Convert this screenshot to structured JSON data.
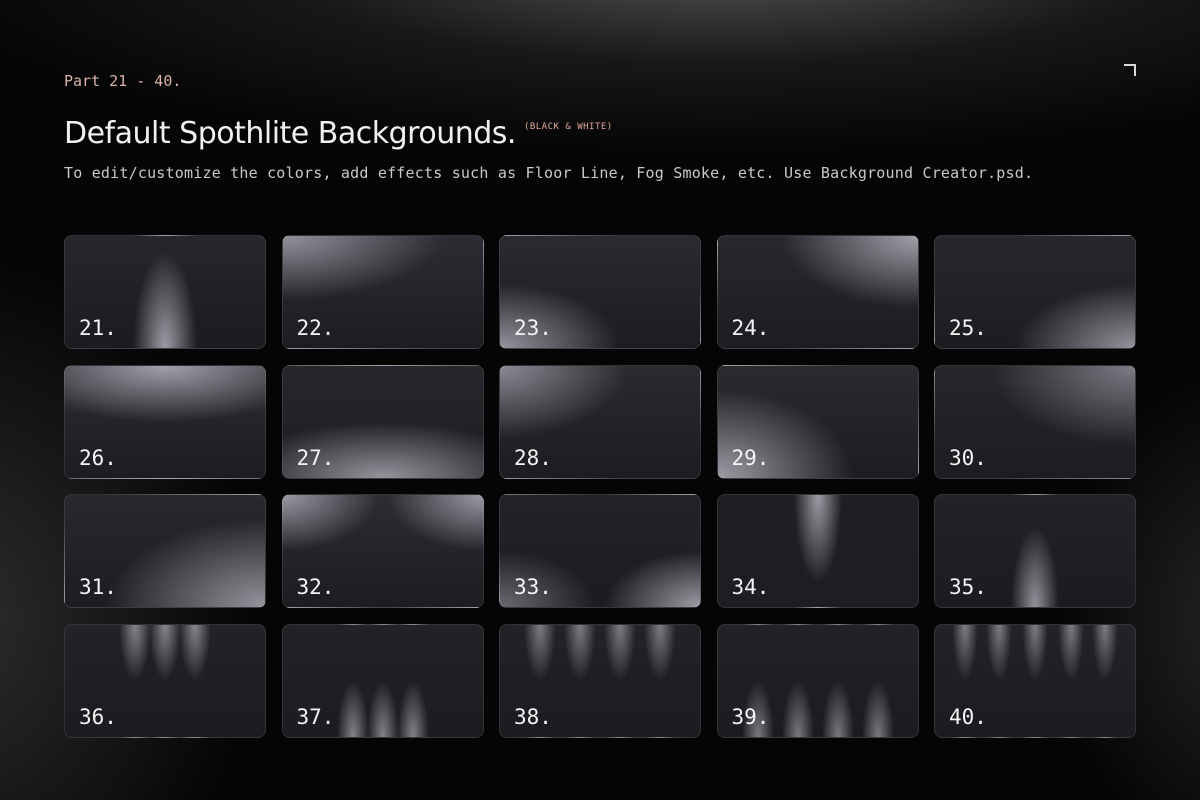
{
  "header": {
    "part": "Part 21 - 40.",
    "title": "Default Spothlite Backgrounds.",
    "tag": "(BLACK & WHITE)",
    "subtitle": "To edit/customize the colors, add effects such as Floor Line, Fog Smoke, etc. Use Background Creator.psd."
  },
  "colors": {
    "accent": "#d9b3a9",
    "tag": "#e0a79a",
    "text": "#f1f1f1",
    "background": "#050505"
  },
  "cards": [
    {
      "label": "21."
    },
    {
      "label": "22."
    },
    {
      "label": "23."
    },
    {
      "label": "24."
    },
    {
      "label": "25."
    },
    {
      "label": "26."
    },
    {
      "label": "27."
    },
    {
      "label": "28."
    },
    {
      "label": "29."
    },
    {
      "label": "30."
    },
    {
      "label": "31."
    },
    {
      "label": "32."
    },
    {
      "label": "33."
    },
    {
      "label": "34."
    },
    {
      "label": "35."
    },
    {
      "label": "36."
    },
    {
      "label": "37."
    },
    {
      "label": "38."
    },
    {
      "label": "39."
    },
    {
      "label": "40."
    }
  ]
}
